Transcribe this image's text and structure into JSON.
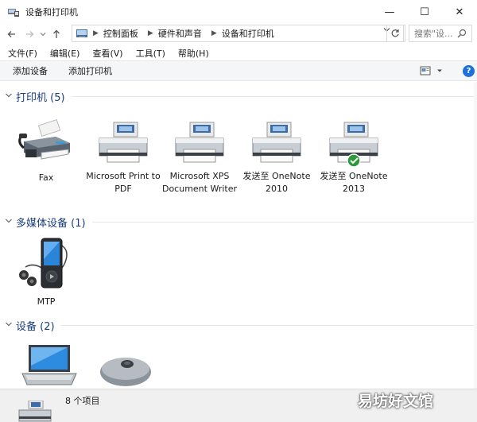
{
  "window": {
    "title": "设备和打印机",
    "minimize": "—",
    "maximize": "☐",
    "close": "✕"
  },
  "address": {
    "breadcrumbs": [
      "控制面板",
      "硬件和声音",
      "设备和打印机"
    ],
    "search_placeholder": "搜索\"设...",
    "refresh_icon": "refresh-icon",
    "dropdown_icon": "chevron-down-icon"
  },
  "menu": {
    "items": [
      "文件(F)",
      "编辑(E)",
      "查看(V)",
      "工具(T)",
      "帮助(H)"
    ]
  },
  "commands": {
    "add_device": "添加设备",
    "add_printer": "添加打印机",
    "help": "?"
  },
  "groups": {
    "printers": {
      "title": "打印机 (5)",
      "items": [
        {
          "label": "Fax"
        },
        {
          "label": "Microsoft Print to PDF"
        },
        {
          "label": "Microsoft XPS Document Writer"
        },
        {
          "label": "发送至 OneNote 2010"
        },
        {
          "label": "发送至 OneNote 2013",
          "default": true
        }
      ]
    },
    "media": {
      "title": "多媒体设备 (1)",
      "items": [
        {
          "label": "MTP"
        }
      ]
    },
    "devices": {
      "title": "设备 (2)",
      "items": [
        {
          "label": ""
        },
        {
          "label": ""
        }
      ]
    }
  },
  "status": {
    "count": "8 个项目"
  },
  "watermark": "易坊好文馆",
  "colors": {
    "group_title": "#1a3e7a",
    "default_check": "#2b9a3a",
    "help_blue": "#1e6fd9"
  }
}
